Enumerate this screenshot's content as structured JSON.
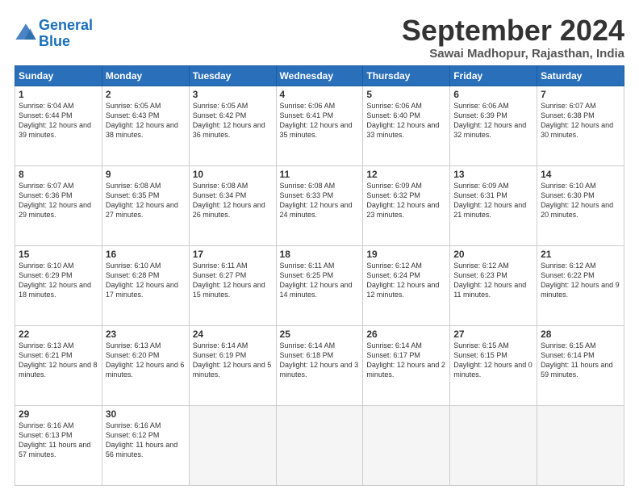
{
  "logo": {
    "line1": "General",
    "line2": "Blue"
  },
  "title": "September 2024",
  "subtitle": "Sawai Madhopur, Rajasthan, India",
  "days": [
    "Sunday",
    "Monday",
    "Tuesday",
    "Wednesday",
    "Thursday",
    "Friday",
    "Saturday"
  ],
  "weeks": [
    [
      {
        "day": "1",
        "sunrise": "6:04 AM",
        "sunset": "6:44 PM",
        "daylight": "12 hours and 39 minutes."
      },
      {
        "day": "2",
        "sunrise": "6:05 AM",
        "sunset": "6:43 PM",
        "daylight": "12 hours and 38 minutes."
      },
      {
        "day": "3",
        "sunrise": "6:05 AM",
        "sunset": "6:42 PM",
        "daylight": "12 hours and 36 minutes."
      },
      {
        "day": "4",
        "sunrise": "6:06 AM",
        "sunset": "6:41 PM",
        "daylight": "12 hours and 35 minutes."
      },
      {
        "day": "5",
        "sunrise": "6:06 AM",
        "sunset": "6:40 PM",
        "daylight": "12 hours and 33 minutes."
      },
      {
        "day": "6",
        "sunrise": "6:06 AM",
        "sunset": "6:39 PM",
        "daylight": "12 hours and 32 minutes."
      },
      {
        "day": "7",
        "sunrise": "6:07 AM",
        "sunset": "6:38 PM",
        "daylight": "12 hours and 30 minutes."
      }
    ],
    [
      {
        "day": "8",
        "sunrise": "6:07 AM",
        "sunset": "6:36 PM",
        "daylight": "12 hours and 29 minutes."
      },
      {
        "day": "9",
        "sunrise": "6:08 AM",
        "sunset": "6:35 PM",
        "daylight": "12 hours and 27 minutes."
      },
      {
        "day": "10",
        "sunrise": "6:08 AM",
        "sunset": "6:34 PM",
        "daylight": "12 hours and 26 minutes."
      },
      {
        "day": "11",
        "sunrise": "6:08 AM",
        "sunset": "6:33 PM",
        "daylight": "12 hours and 24 minutes."
      },
      {
        "day": "12",
        "sunrise": "6:09 AM",
        "sunset": "6:32 PM",
        "daylight": "12 hours and 23 minutes."
      },
      {
        "day": "13",
        "sunrise": "6:09 AM",
        "sunset": "6:31 PM",
        "daylight": "12 hours and 21 minutes."
      },
      {
        "day": "14",
        "sunrise": "6:10 AM",
        "sunset": "6:30 PM",
        "daylight": "12 hours and 20 minutes."
      }
    ],
    [
      {
        "day": "15",
        "sunrise": "6:10 AM",
        "sunset": "6:29 PM",
        "daylight": "12 hours and 18 minutes."
      },
      {
        "day": "16",
        "sunrise": "6:10 AM",
        "sunset": "6:28 PM",
        "daylight": "12 hours and 17 minutes."
      },
      {
        "day": "17",
        "sunrise": "6:11 AM",
        "sunset": "6:27 PM",
        "daylight": "12 hours and 15 minutes."
      },
      {
        "day": "18",
        "sunrise": "6:11 AM",
        "sunset": "6:25 PM",
        "daylight": "12 hours and 14 minutes."
      },
      {
        "day": "19",
        "sunrise": "6:12 AM",
        "sunset": "6:24 PM",
        "daylight": "12 hours and 12 minutes."
      },
      {
        "day": "20",
        "sunrise": "6:12 AM",
        "sunset": "6:23 PM",
        "daylight": "12 hours and 11 minutes."
      },
      {
        "day": "21",
        "sunrise": "6:12 AM",
        "sunset": "6:22 PM",
        "daylight": "12 hours and 9 minutes."
      }
    ],
    [
      {
        "day": "22",
        "sunrise": "6:13 AM",
        "sunset": "6:21 PM",
        "daylight": "12 hours and 8 minutes."
      },
      {
        "day": "23",
        "sunrise": "6:13 AM",
        "sunset": "6:20 PM",
        "daylight": "12 hours and 6 minutes."
      },
      {
        "day": "24",
        "sunrise": "6:14 AM",
        "sunset": "6:19 PM",
        "daylight": "12 hours and 5 minutes."
      },
      {
        "day": "25",
        "sunrise": "6:14 AM",
        "sunset": "6:18 PM",
        "daylight": "12 hours and 3 minutes."
      },
      {
        "day": "26",
        "sunrise": "6:14 AM",
        "sunset": "6:17 PM",
        "daylight": "12 hours and 2 minutes."
      },
      {
        "day": "27",
        "sunrise": "6:15 AM",
        "sunset": "6:15 PM",
        "daylight": "12 hours and 0 minutes."
      },
      {
        "day": "28",
        "sunrise": "6:15 AM",
        "sunset": "6:14 PM",
        "daylight": "11 hours and 59 minutes."
      }
    ],
    [
      {
        "day": "29",
        "sunrise": "6:16 AM",
        "sunset": "6:13 PM",
        "daylight": "11 hours and 57 minutes."
      },
      {
        "day": "30",
        "sunrise": "6:16 AM",
        "sunset": "6:12 PM",
        "daylight": "11 hours and 56 minutes."
      },
      null,
      null,
      null,
      null,
      null
    ]
  ]
}
